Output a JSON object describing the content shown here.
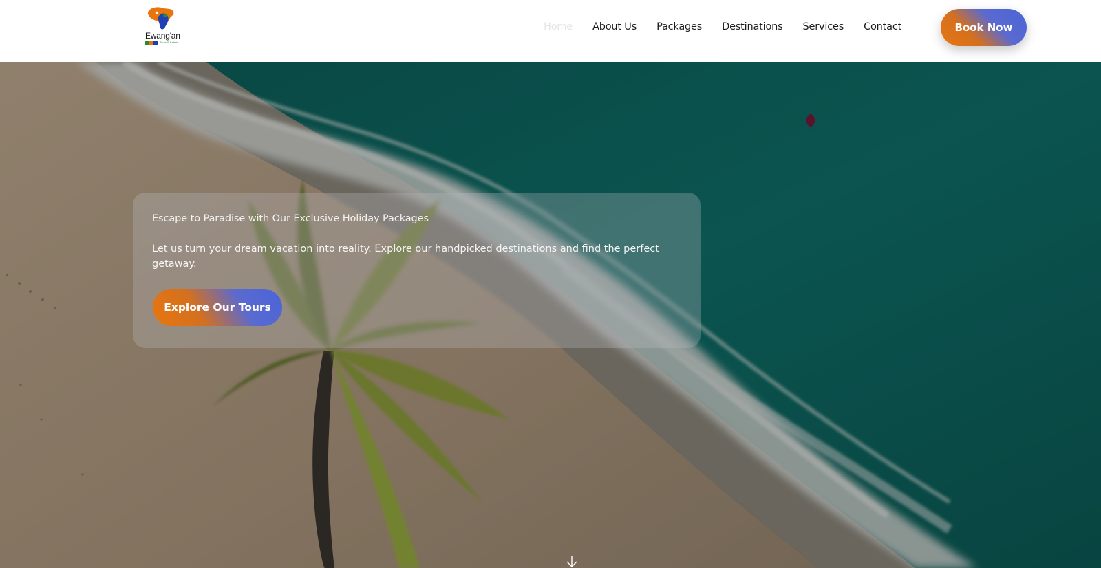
{
  "brand": {
    "logo_name": "Ewang'an",
    "logo_tagline": "Tours & Safaris",
    "logo_colors": [
      "#e8760f",
      "#1f3fb5",
      "#2e8b2e"
    ]
  },
  "nav": {
    "items": [
      {
        "label": "Home",
        "active": true
      },
      {
        "label": "About Us"
      },
      {
        "label": "Packages"
      },
      {
        "label": "Destinations"
      },
      {
        "label": "Services"
      },
      {
        "label": "Contact"
      }
    ],
    "book_now_label": "Book Now"
  },
  "hero": {
    "title": "Escape to Paradise with Our Exclusive Holiday Packages",
    "subtitle": "Let us turn your dream vacation into reality. Explore our handpicked destinations and find the perfect getaway.",
    "cta_label": "Explore Our Tours",
    "scroll_icon": "arrow-down-icon"
  },
  "colors": {
    "accent_orange": "#e8760f",
    "accent_blue": "#4a64d8",
    "ocean": "#0c6460",
    "sand": "#b8a58c"
  }
}
